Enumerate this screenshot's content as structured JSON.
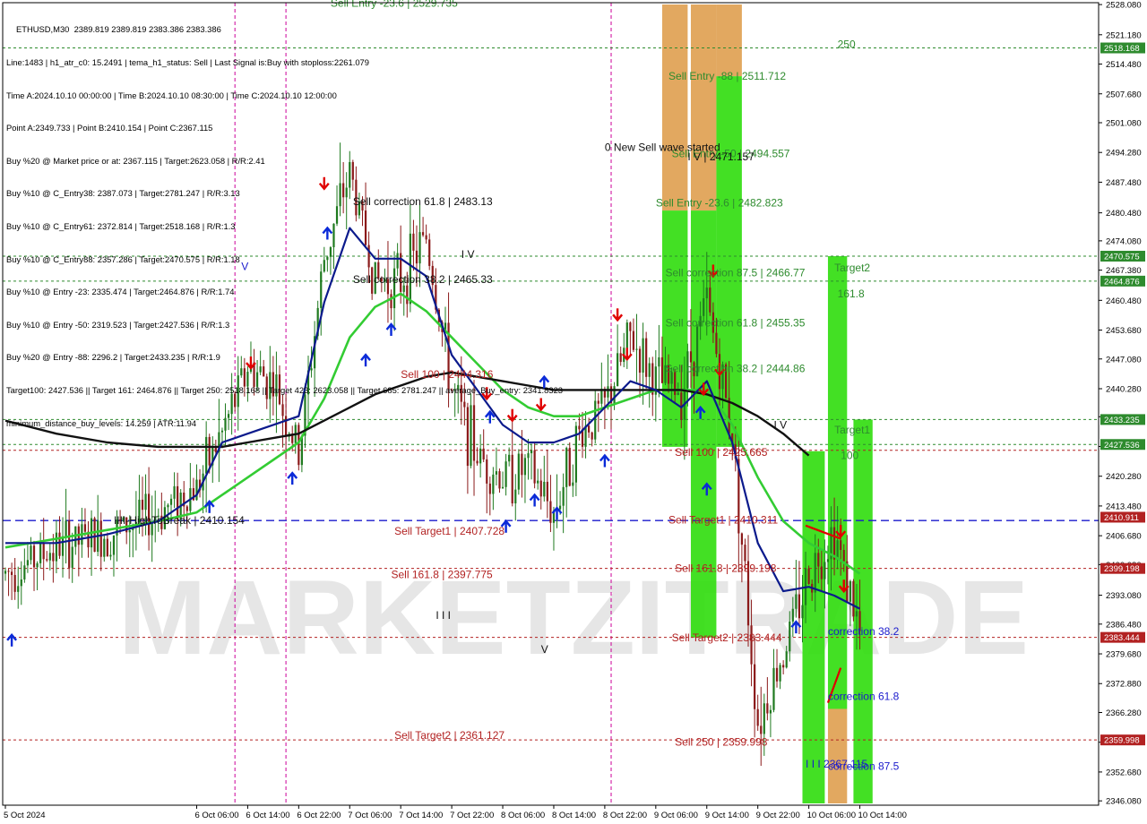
{
  "symbol_header": "ETHUSD,M30  2389.819 2389.819 2383.386 2383.386",
  "info_lines": [
    "Line:1483 | h1_atr_c0: 15.2491 | tema_h1_status: Sell | Last Signal is:Buy with stoploss:2261.079",
    "Time A:2024.10.10 00:00:00 | Time B:2024.10.10 08:30:00 | Time C:2024.10.10 12:00:00",
    "Point A:2349.733 | Point B:2410.154 | Point C:2367.115",
    "Buy %20 @ Market price or at: 2367.115 | Target:2623.058 | R/R:2.41",
    "Buy %10 @ C_Entry38: 2387.073 | Target:2781.247 | R/R:3.13",
    "Buy %10 @ C_Entry61: 2372.814 | Target:2518.168 | R/R:1.3",
    "Buy %10 @ C_Entry88: 2357.286 | Target:2470.575 | R/R:1.18",
    "Buy %10 @ Entry -23: 2335.474 | Target:2464.876 | R/R:1.74",
    "Buy %10 @ Entry -50: 2319.523 | Target:2427.536 | R/R:1.3",
    "Buy %20 @ Entry -88: 2296.2 | Target:2433.235 | R/R:1.9",
    "Target100: 2427.536 || Target 161: 2464.876 || Target 250: 2518.168 || Target 423: 2623.058 || Target 685: 2781.247 || average_Buy_entry: 2341.8323",
    "minimum_distance_buy_levels: 14.259 | ATR:11.94"
  ],
  "watermark": "MARKETZITRADE",
  "colors": {
    "background": "#ffffff",
    "bull_candle": "#1f7a1f",
    "bear_candle": "#8b1a1a",
    "ema_fast": "#0b1a8c",
    "ema_mid": "#33cc33",
    "ema_slow": "#111111",
    "level_green": "#2e8b2e",
    "level_red": "#b22222",
    "level_blue": "#1a1acc",
    "zone_green": "#33dd11",
    "zone_orange": "#dd9944",
    "label_red": "#b22222",
    "label_green": "#2e8b2e",
    "label_blue": "#1a1acc",
    "vline_magenta": "#cc0099"
  },
  "chart_data": {
    "type": "candlestick",
    "title": "",
    "xlabel": "",
    "ylabel": "",
    "ylim": [
      2345.5,
      2528.1
    ],
    "xlim": [
      "2024-10-05 00:00",
      "2024-10-10 18:00"
    ],
    "y_ticks": [
      "2528.080",
      "2521.180",
      "2514.480",
      "2507.680",
      "2501.080",
      "2494.280",
      "2487.480",
      "2480.480",
      "2474.080",
      "2467.380",
      "2460.480",
      "2453.680",
      "2447.080",
      "2440.280",
      "2433.880",
      "2427.080",
      "2420.280",
      "2413.480",
      "2406.680",
      "2400.080",
      "2393.080",
      "2386.480",
      "2379.680",
      "2372.880",
      "2366.280",
      "2359.480",
      "2352.680",
      "2346.080"
    ],
    "x_ticks": [
      "5 Oct 2024",
      "6 Oct 06:00",
      "6 Oct 14:00",
      "6 Oct 22:00",
      "7 Oct 06:00",
      "7 Oct 14:00",
      "7 Oct 22:00",
      "8 Oct 06:00",
      "8 Oct 14:00",
      "8 Oct 22:00",
      "9 Oct 06:00",
      "9 Oct 14:00",
      "9 Oct 22:00",
      "10 Oct 06:00",
      "10 Oct 14:00"
    ],
    "x_tick_times": [
      "2024-10-05 00:00",
      "2024-10-06 06:00",
      "2024-10-06 14:00",
      "2024-10-06 22:00",
      "2024-10-07 06:00",
      "2024-10-07 14:00",
      "2024-10-07 22:00",
      "2024-10-08 06:00",
      "2024-10-08 14:00",
      "2024-10-08 22:00",
      "2024-10-09 06:00",
      "2024-10-09 14:00",
      "2024-10-09 22:00",
      "2024-10-10 06:00",
      "2024-10-10 14:00"
    ],
    "price_path_time": [
      "2024-10-05 00:00",
      "2024-10-05 08:00",
      "2024-10-05 16:00",
      "2024-10-06 00:00",
      "2024-10-06 06:00",
      "2024-10-06 10:00",
      "2024-10-06 14:00",
      "2024-10-06 18:00",
      "2024-10-06 22:00",
      "2024-10-07 02:00",
      "2024-10-07 06:00",
      "2024-10-07 10:00",
      "2024-10-07 14:00",
      "2024-10-07 18:00",
      "2024-10-07 22:00",
      "2024-10-08 02:00",
      "2024-10-08 06:00",
      "2024-10-08 10:00",
      "2024-10-08 14:00",
      "2024-10-08 18:00",
      "2024-10-08 22:00",
      "2024-10-09 02:00",
      "2024-10-09 06:00",
      "2024-10-09 10:00",
      "2024-10-09 14:00",
      "2024-10-09 18:00",
      "2024-10-09 22:00",
      "2024-10-10 02:00",
      "2024-10-10 06:00",
      "2024-10-10 10:00",
      "2024-10-10 14:00"
    ],
    "price_path": [
      2398,
      2404,
      2407,
      2412,
      2418,
      2430,
      2445,
      2442,
      2425,
      2470,
      2490,
      2465,
      2465,
      2475,
      2440,
      2425,
      2420,
      2422,
      2412,
      2430,
      2436,
      2452,
      2442,
      2440,
      2460,
      2430,
      2364,
      2380,
      2398,
      2408,
      2384
    ],
    "ema_fast_time": [
      "2024-10-05 00:00",
      "2024-10-05 08:00",
      "2024-10-05 16:00",
      "2024-10-06 00:00",
      "2024-10-06 06:00",
      "2024-10-06 10:00",
      "2024-10-06 14:00",
      "2024-10-06 18:00",
      "2024-10-06 22:00",
      "2024-10-07 02:00",
      "2024-10-07 06:00",
      "2024-10-07 10:00",
      "2024-10-07 14:00",
      "2024-10-07 18:00",
      "2024-10-07 22:00",
      "2024-10-08 02:00",
      "2024-10-08 06:00",
      "2024-10-08 10:00",
      "2024-10-08 14:00",
      "2024-10-08 18:00",
      "2024-10-08 22:00",
      "2024-10-09 02:00",
      "2024-10-09 06:00",
      "2024-10-09 10:00",
      "2024-10-09 14:00",
      "2024-10-09 18:00",
      "2024-10-09 22:00",
      "2024-10-10 02:00",
      "2024-10-10 06:00",
      "2024-10-10 10:00",
      "2024-10-10 14:00"
    ],
    "ema_fast": [
      2405,
      2405,
      2407,
      2410,
      2416,
      2428,
      2430,
      2432,
      2434,
      2460,
      2477,
      2470,
      2470,
      2466,
      2448,
      2440,
      2432,
      2428,
      2428,
      2430,
      2436,
      2442,
      2440,
      2436,
      2442,
      2428,
      2405,
      2394,
      2395,
      2393,
      2390
    ],
    "ema_mid_time": [
      "2024-10-05 00:00",
      "2024-10-05 08:00",
      "2024-10-05 16:00",
      "2024-10-06 00:00",
      "2024-10-06 06:00",
      "2024-10-06 10:00",
      "2024-10-06 14:00",
      "2024-10-06 18:00",
      "2024-10-06 22:00",
      "2024-10-07 02:00",
      "2024-10-07 06:00",
      "2024-10-07 10:00",
      "2024-10-07 14:00",
      "2024-10-07 18:00",
      "2024-10-07 22:00",
      "2024-10-08 02:00",
      "2024-10-08 06:00",
      "2024-10-08 10:00",
      "2024-10-08 14:00",
      "2024-10-08 18:00",
      "2024-10-08 22:00",
      "2024-10-09 02:00",
      "2024-10-09 06:00",
      "2024-10-09 10:00",
      "2024-10-09 14:00",
      "2024-10-09 18:00",
      "2024-10-09 22:00",
      "2024-10-10 02:00",
      "2024-10-10 06:00",
      "2024-10-10 10:00",
      "2024-10-10 14:00"
    ],
    "ema_mid": [
      2404,
      2406,
      2408,
      2410,
      2412,
      2416,
      2420,
      2424,
      2428,
      2438,
      2452,
      2459,
      2462,
      2458,
      2452,
      2446,
      2440,
      2436,
      2434,
      2434,
      2436,
      2438,
      2440,
      2440,
      2440,
      2432,
      2420,
      2410,
      2405,
      2402,
      2398
    ],
    "ema_slow_time": [
      "2024-10-05 00:00",
      "2024-10-05 08:00",
      "2024-10-05 16:00",
      "2024-10-06 00:00",
      "2024-10-06 06:00",
      "2024-10-06 10:00",
      "2024-10-06 14:00",
      "2024-10-06 18:00",
      "2024-10-06 22:00",
      "2024-10-07 02:00",
      "2024-10-07 06:00",
      "2024-10-07 10:00",
      "2024-10-07 14:00",
      "2024-10-07 18:00",
      "2024-10-07 22:00",
      "2024-10-08 02:00",
      "2024-10-08 06:00",
      "2024-10-08 10:00",
      "2024-10-08 14:00",
      "2024-10-08 18:00",
      "2024-10-08 22:00",
      "2024-10-09 02:00",
      "2024-10-09 06:00",
      "2024-10-09 10:00",
      "2024-10-09 14:00",
      "2024-10-09 18:00",
      "2024-10-09 22:00",
      "2024-10-10 02:00",
      "2024-10-10 06:00"
    ],
    "ema_slow": [
      2433,
      2430,
      2428,
      2427,
      2427,
      2427,
      2428,
      2429,
      2430,
      2433,
      2436,
      2439,
      2441,
      2443,
      2444,
      2443,
      2442,
      2441,
      2440,
      2440,
      2440,
      2440,
      2440,
      2440,
      2439,
      2437,
      2434,
      2430,
      2425
    ],
    "highlighted_levels": [
      {
        "value": 2518.168,
        "label": "2518.168",
        "color": "green"
      },
      {
        "value": 2470.575,
        "label": "2470.575",
        "color": "green"
      },
      {
        "value": 2464.876,
        "label": "2464.876",
        "color": "green"
      },
      {
        "value": 2433.235,
        "label": "2433.235",
        "color": "green"
      },
      {
        "value": 2427.536,
        "label": "2427.536",
        "color": "green"
      },
      {
        "value": 2410.911,
        "label": "2410.911",
        "color": "red"
      },
      {
        "value": 2399.198,
        "label": "2399.198",
        "color": "red"
      },
      {
        "value": 2383.444,
        "label": "2383.444",
        "color": "red"
      },
      {
        "value": 2359.998,
        "label": "2359.998",
        "color": "red"
      }
    ],
    "horizontal_lines": [
      {
        "value": 2518.168,
        "color": "green",
        "dash": true
      },
      {
        "value": 2470.575,
        "color": "green",
        "dash": true
      },
      {
        "value": 2464.876,
        "color": "green",
        "dash": true
      },
      {
        "value": 2433.235,
        "color": "green",
        "dash": true
      },
      {
        "value": 2427.536,
        "color": "green",
        "dash": true
      },
      {
        "value": 2426.2,
        "color": "red",
        "dash": true
      },
      {
        "value": 2410.154,
        "color": "blue",
        "dash": true
      },
      {
        "value": 2399.198,
        "color": "red",
        "dash": true
      },
      {
        "value": 2383.444,
        "color": "red",
        "dash": true
      },
      {
        "value": 2359.998,
        "color": "red",
        "dash": true
      }
    ],
    "vertical_lines": [
      {
        "time": "2024-10-06 12:00",
        "color": "magenta"
      },
      {
        "time": "2024-10-06 20:00",
        "color": "magenta"
      },
      {
        "time": "2024-10-08 23:00",
        "color": "magenta"
      }
    ],
    "zones": [
      {
        "t0": "2024-10-09 07:00",
        "t1": "2024-10-09 11:00",
        "y0": 2528.1,
        "y1": 2481.0,
        "color": "orange"
      },
      {
        "t0": "2024-10-09 11:30",
        "t1": "2024-10-09 15:30",
        "y0": 2528.1,
        "y1": 2481.0,
        "color": "orange"
      },
      {
        "t0": "2024-10-09 15:30",
        "t1": "2024-10-09 19:30",
        "y0": 2528.1,
        "y1": 2511.7,
        "color": "orange"
      },
      {
        "t0": "2024-10-09 07:00",
        "t1": "2024-10-09 11:00",
        "y0": 2481.0,
        "y1": 2427.0,
        "color": "green"
      },
      {
        "t0": "2024-10-09 11:30",
        "t1": "2024-10-09 15:30",
        "y0": 2481.0,
        "y1": 2466.9,
        "color": "green"
      },
      {
        "t0": "2024-10-09 15:30",
        "t1": "2024-10-09 19:30",
        "y0": 2511.7,
        "y1": 2427.0,
        "color": "green"
      },
      {
        "t0": "2024-10-09 11:30",
        "t1": "2024-10-09 15:30",
        "y0": 2466.9,
        "y1": 2383.4,
        "color": "green"
      },
      {
        "t0": "2024-10-10 05:00",
        "t1": "2024-10-10 08:30",
        "y0": 2426.0,
        "y1": 2345.5,
        "color": "green"
      },
      {
        "t0": "2024-10-10 09:00",
        "t1": "2024-10-10 12:00",
        "y0": 2470.575,
        "y1": 2367.1,
        "color": "green"
      },
      {
        "t0": "2024-10-10 09:00",
        "t1": "2024-10-10 12:00",
        "y0": 2367.1,
        "y1": 2345.5,
        "color": "orange"
      },
      {
        "t0": "2024-10-10 13:00",
        "t1": "2024-10-10 16:00",
        "y0": 2433.235,
        "y1": 2345.5,
        "color": "green"
      }
    ],
    "annotations": [
      {
        "text": "Sell Entry -23.6 | 2529.735",
        "t": "2024-10-07 03:00",
        "y": 2528.4,
        "color": "green"
      },
      {
        "text": "Sell Entry -88 | 2511.712",
        "t": "2024-10-09 08:00",
        "y": 2511.7,
        "color": "green"
      },
      {
        "text": "Sell Entry -50 | 2494.557",
        "t": "2024-10-09 08:30",
        "y": 2494.0,
        "color": "green"
      },
      {
        "text": "I V | 2471.157",
        "t": "2024-10-09 11:00",
        "y": 2493.3,
        "color": "black"
      },
      {
        "text": "0 New Sell wave started",
        "t": "2024-10-08 22:00",
        "y": 2495.5,
        "color": "black"
      },
      {
        "text": "Sell Entry -23.6 | 2482.823",
        "t": "2024-10-09 06:00",
        "y": 2482.8,
        "color": "green"
      },
      {
        "text": "Sell correction 61.8 | 2483.13",
        "t": "2024-10-07 06:30",
        "y": 2483.1,
        "color": "black"
      },
      {
        "text": "Sell correction 38.2 | 2465.33",
        "t": "2024-10-07 06:30",
        "y": 2465.3,
        "color": "black"
      },
      {
        "text": "Sell correction 87.5 | 2466.77",
        "t": "2024-10-09 07:30",
        "y": 2466.8,
        "color": "green"
      },
      {
        "text": "Sell correction 61.8 | 2455.35",
        "t": "2024-10-09 07:30",
        "y": 2455.3,
        "color": "green"
      },
      {
        "text": "Sell correction 38.2 | 2444.86",
        "t": "2024-10-09 07:30",
        "y": 2444.9,
        "color": "green"
      },
      {
        "text": "Sell 100 | 2444.316",
        "t": "2024-10-07 14:00",
        "y": 2443.6,
        "color": "red"
      },
      {
        "text": "Sell 100 | 2425.665",
        "t": "2024-10-09 09:00",
        "y": 2425.7,
        "color": "red"
      },
      {
        "text": "Sell Target1 | 2407.728",
        "t": "2024-10-07 13:00",
        "y": 2407.7,
        "color": "red"
      },
      {
        "text": "Sell Target1 | 2410.311",
        "t": "2024-10-09 08:00",
        "y": 2410.3,
        "color": "red"
      },
      {
        "text": "Sell 161.8 | 2397.775",
        "t": "2024-10-07 12:30",
        "y": 2397.8,
        "color": "red"
      },
      {
        "text": "Sell 161.8 | 2399.198",
        "t": "2024-10-09 09:00",
        "y": 2399.2,
        "color": "red"
      },
      {
        "text": "Sell Target2 | 2383.444",
        "t": "2024-10-09 08:30",
        "y": 2383.4,
        "color": "red"
      },
      {
        "text": "Sell Target2 | 2361.127",
        "t": "2024-10-07 13:00",
        "y": 2361.1,
        "color": "red"
      },
      {
        "text": "Sell 250 | 2359.998",
        "t": "2024-10-09 09:00",
        "y": 2359.5,
        "color": "red"
      },
      {
        "text": "IIII-HighToBreak | 2410.154",
        "t": "2024-10-05 17:00",
        "y": 2410.2,
        "color": "black"
      },
      {
        "text": "I V",
        "t": "2024-10-07 23:30",
        "y": 2471.0,
        "color": "black"
      },
      {
        "text": "I V",
        "t": "2024-10-10 00:30",
        "y": 2432.0,
        "color": "black"
      },
      {
        "text": "V",
        "t": "2024-10-06 13:00",
        "y": 2468.2,
        "color": "blue"
      },
      {
        "text": "V",
        "t": "2024-10-08 12:00",
        "y": 2380.7,
        "color": "black"
      },
      {
        "text": "I I I",
        "t": "2024-10-07 19:30",
        "y": 2388.5,
        "color": "black"
      },
      {
        "text": "I I I  2367.115",
        "t": "2024-10-10 05:30",
        "y": 2354.5,
        "color": "blue"
      },
      {
        "text": "250",
        "t": "2024-10-10 10:30",
        "y": 2519.0,
        "color": "green"
      },
      {
        "text": "Target2",
        "t": "2024-10-10 10:00",
        "y": 2467.9,
        "color": "green"
      },
      {
        "text": "161.8",
        "t": "2024-10-10 10:30",
        "y": 2462.0,
        "color": "green"
      },
      {
        "text": "Target1",
        "t": "2024-10-10 10:00",
        "y": 2430.9,
        "color": "green"
      },
      {
        "text": "100",
        "t": "2024-10-10 11:00",
        "y": 2425.0,
        "color": "green"
      },
      {
        "text": "correction 38.2",
        "t": "2024-10-10 09:00",
        "y": 2384.8,
        "color": "blue"
      },
      {
        "text": "correction 61.8",
        "t": "2024-10-10 09:00",
        "y": 2370.0,
        "color": "blue"
      },
      {
        "text": "correction 87.5",
        "t": "2024-10-10 09:00",
        "y": 2354.0,
        "color": "blue"
      }
    ],
    "arrows_down": [
      {
        "t": "2024-10-06 14:30",
        "y": 2446.0
      },
      {
        "t": "2024-10-07 02:00",
        "y": 2487.0
      },
      {
        "t": "2024-10-08 03:30",
        "y": 2439.0
      },
      {
        "t": "2024-10-08 07:30",
        "y": 2434.0
      },
      {
        "t": "2024-10-08 12:00",
        "y": 2436.5
      },
      {
        "t": "2024-10-09 00:00",
        "y": 2457.0
      },
      {
        "t": "2024-10-09 01:30",
        "y": 2448.0
      },
      {
        "t": "2024-10-09 13:30",
        "y": 2440.0
      },
      {
        "t": "2024-10-09 15:00",
        "y": 2467.0
      },
      {
        "t": "2024-10-09 16:00",
        "y": 2444.5
      },
      {
        "t": "2024-10-10 11:00",
        "y": 2407.5
      },
      {
        "t": "2024-10-10 11:30",
        "y": 2395.0
      }
    ],
    "arrows_up": [
      {
        "t": "2024-10-05 01:00",
        "y": 2383.0
      },
      {
        "t": "2024-10-06 08:00",
        "y": 2413.5
      },
      {
        "t": "2024-10-06 21:00",
        "y": 2420.0
      },
      {
        "t": "2024-10-07 02:30",
        "y": 2476.0
      },
      {
        "t": "2024-10-07 08:30",
        "y": 2447.0
      },
      {
        "t": "2024-10-07 12:30",
        "y": 2454.0
      },
      {
        "t": "2024-10-08 04:00",
        "y": 2434.0
      },
      {
        "t": "2024-10-08 06:30",
        "y": 2409.0
      },
      {
        "t": "2024-10-08 11:00",
        "y": 2415.0
      },
      {
        "t": "2024-10-08 12:30",
        "y": 2442.0
      },
      {
        "t": "2024-10-08 14:30",
        "y": 2412.0
      },
      {
        "t": "2024-10-08 22:00",
        "y": 2424.0
      },
      {
        "t": "2024-10-09 13:00",
        "y": 2435.0
      },
      {
        "t": "2024-10-09 14:00",
        "y": 2417.5
      },
      {
        "t": "2024-10-10 04:00",
        "y": 2386.0
      }
    ],
    "sell_break_line": {
      "t0": "2024-10-10 05:30",
      "y0": 2409.0,
      "t1": "2024-10-10 11:00",
      "y1": 2406.0
    },
    "buy_break_line": {
      "t0": "2024-10-10 09:00",
      "y0": 2368.5,
      "t1": "2024-10-10 11:00",
      "y1": 2376.5
    }
  }
}
